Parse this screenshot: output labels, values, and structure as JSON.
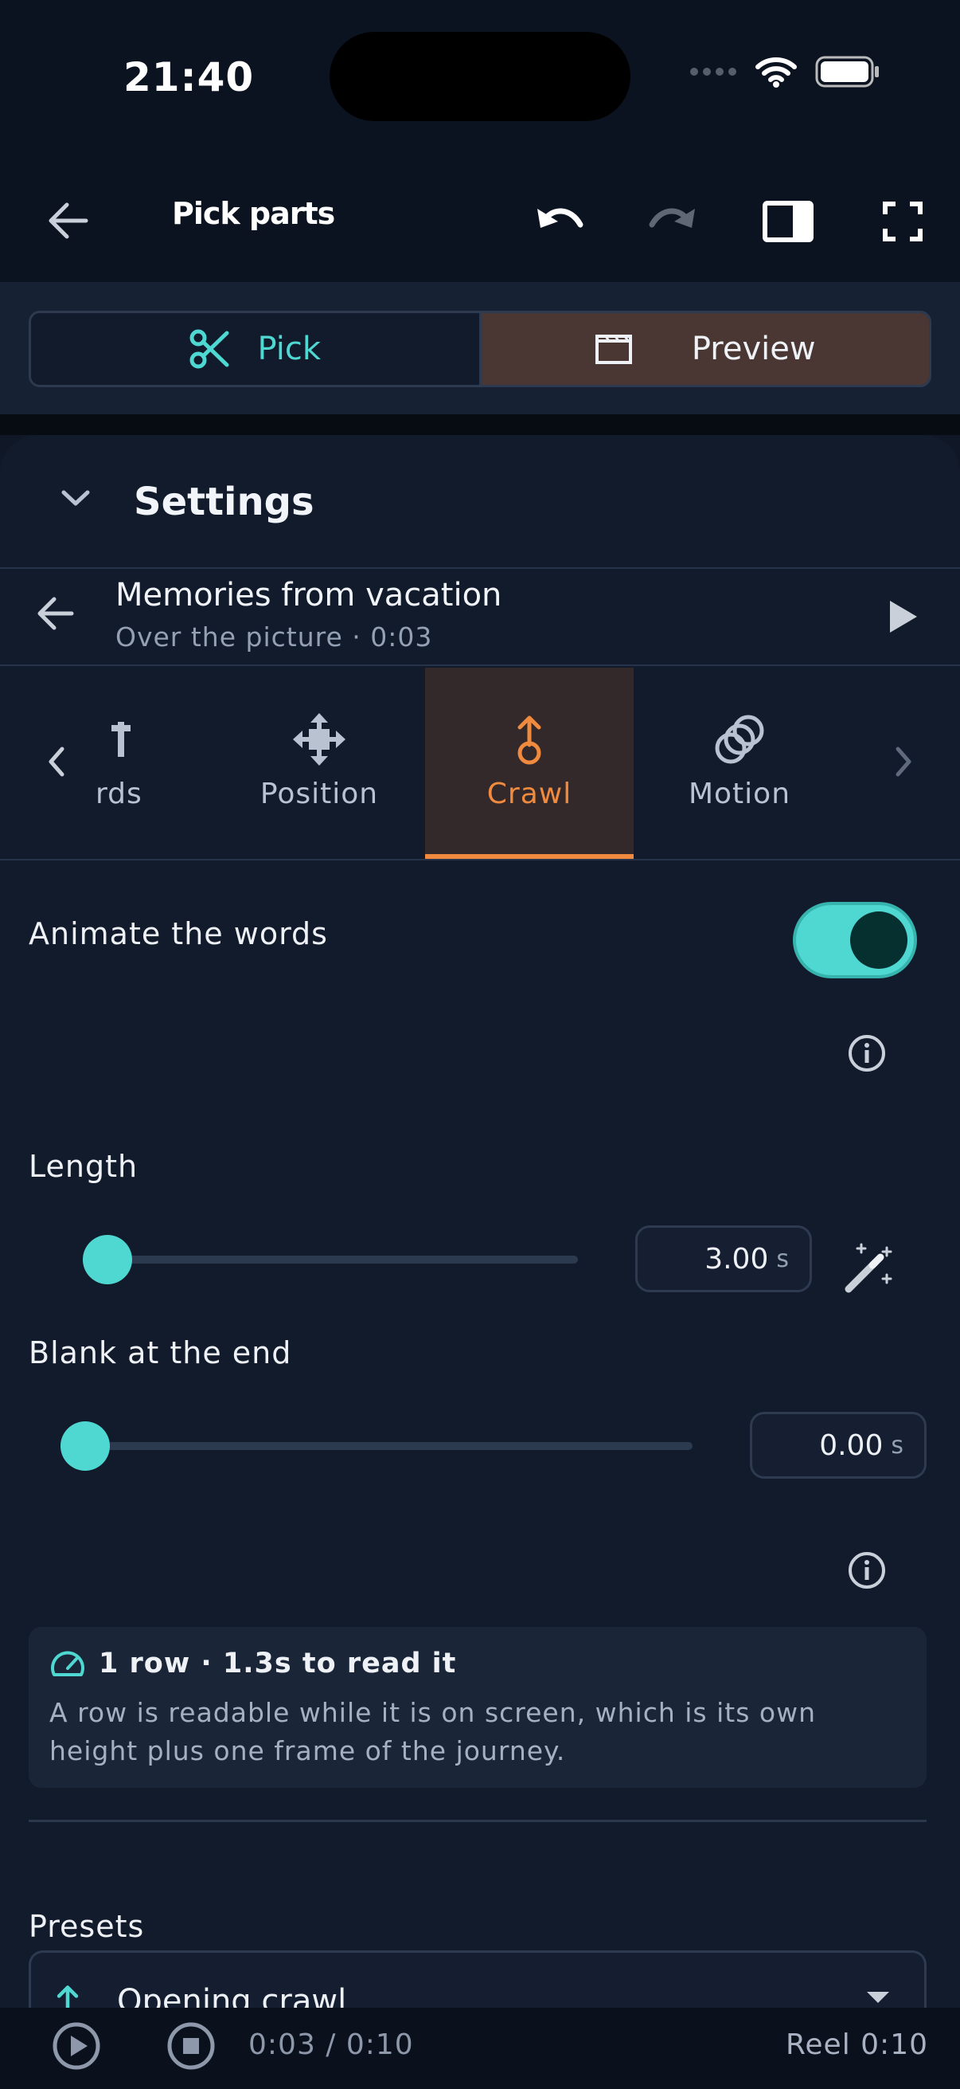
{
  "status_bar": {
    "time": "21:40"
  },
  "app_bar": {
    "title": "Pick parts"
  },
  "mode_switch": {
    "pick_label": "Pick",
    "preview_label": "Preview"
  },
  "settings": {
    "title": "Settings"
  },
  "clip": {
    "title": "Memories from vacation",
    "subtitle": "Over the picture · 0:03"
  },
  "tabs": [
    {
      "label": "rds",
      "icon": "text-icon",
      "active": false
    },
    {
      "label": "Position",
      "icon": "move-icon",
      "active": false
    },
    {
      "label": "Crawl",
      "icon": "crawl-icon",
      "active": true
    },
    {
      "label": "Motion",
      "icon": "motion-icon",
      "active": false
    }
  ],
  "animate": {
    "label": "Animate the words",
    "enabled": true
  },
  "length": {
    "label": "Length",
    "value": "3.00",
    "unit": "s",
    "fraction": 0.05
  },
  "blank_end": {
    "label": "Blank at the end",
    "value": "0.00",
    "unit": "s",
    "fraction": 0.0
  },
  "readability": {
    "title": "1 row · 1.3s to read it",
    "body": "A row is readable while it is on screen, which is its own height plus one frame of the journey."
  },
  "presets": {
    "label": "Presets",
    "selected": "Opening crawl"
  },
  "player": {
    "time": "0:03 / 0:10",
    "reel": "Reel 0:10"
  },
  "colors": {
    "accent": "#4fd8d2",
    "active_tab": "#f08a3e",
    "preview_bg": "#4a3733",
    "background": "#121b2c"
  }
}
